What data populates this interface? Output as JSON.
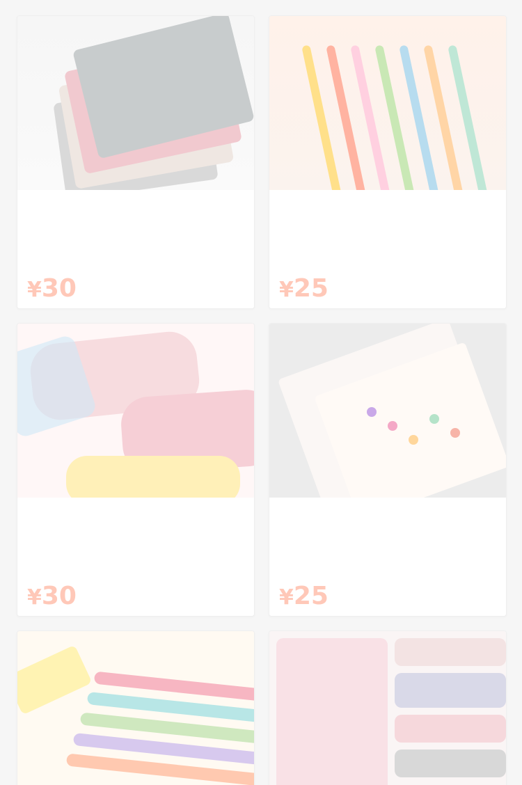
{
  "products": [
    {
      "image_name": "notebook-image",
      "title": "",
      "subtitle": "",
      "currency": "¥",
      "price": "30",
      "sold_label": "",
      "sold_count": ""
    },
    {
      "image_name": "pens-image",
      "title": "",
      "subtitle": "",
      "currency": "¥",
      "price": "25",
      "sold_label": "",
      "sold_count": ""
    },
    {
      "image_name": "pencil-case-image",
      "title": "",
      "subtitle": "",
      "currency": "¥",
      "price": "30",
      "sold_label": "",
      "sold_count": ""
    },
    {
      "image_name": "stickers-image",
      "title": "",
      "subtitle": "",
      "currency": "¥",
      "price": "25",
      "sold_label": "",
      "sold_count": ""
    },
    {
      "image_name": "pencils-image",
      "title": "",
      "subtitle": "",
      "currency": "",
      "price": "",
      "sold_label": "",
      "sold_count": ""
    },
    {
      "image_name": "washi-tape-image",
      "title": "",
      "subtitle": "",
      "currency": "",
      "price": "",
      "sold_label": "",
      "sold_count": ""
    }
  ],
  "colors": {
    "background": "#f6f6f6",
    "card": "#ffffff",
    "price": "#ffc8b8",
    "sold_count": "#ffd8b0",
    "muted_text": "#cfcfcf"
  }
}
